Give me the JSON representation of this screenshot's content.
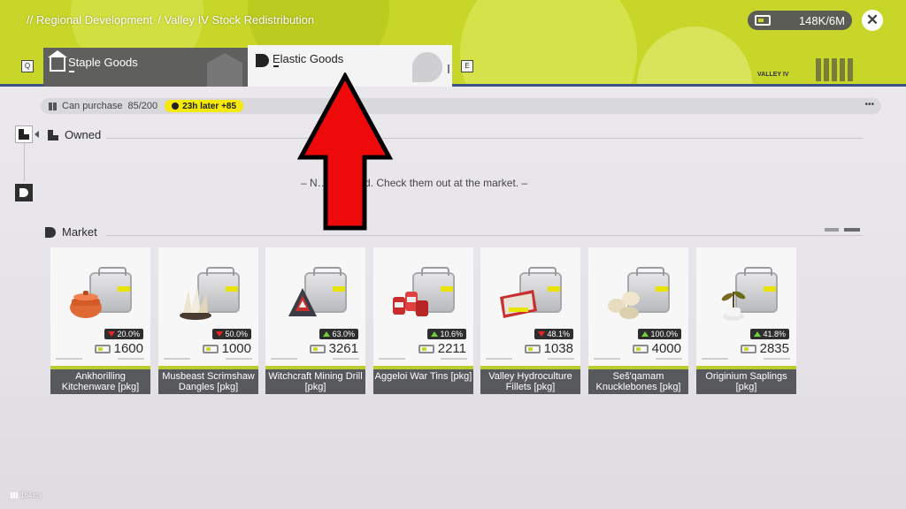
{
  "header": {
    "breadcrumb": [
      "// Regional Development",
      "/ Valley IV Stock Redistribution"
    ],
    "currency": {
      "icon": "currency-icon",
      "value": "148K/6M"
    },
    "close_icon": "close-icon",
    "key_left": "Q",
    "key_right": "E",
    "valley_label": "VALLEY IV",
    "colors": {
      "accent": "#c8d62a",
      "header_stripe": "#3e4f8a"
    }
  },
  "tabs": [
    {
      "label": "Staple Goods",
      "icon": "house-icon",
      "selected": false
    },
    {
      "label": "Elastic Goods",
      "icon": "elastic-icon",
      "selected": true
    }
  ],
  "purchase": {
    "label": "Can purchase",
    "value": "85/200",
    "timer": "23h later +85",
    "more": "•••"
  },
  "owned": {
    "title": "Owned",
    "empty_message": "– N… s owned. Check them out at the market. –"
  },
  "market": {
    "title": "Market",
    "items": [
      {
        "name": "Ankhorilling Kitchenware [pkg]",
        "change": "20.0%",
        "direction": "down",
        "price": "1600",
        "icon": "pot-icon"
      },
      {
        "name": "Musbeast Scrimshaw Dangles [pkg]",
        "change": "50.0%",
        "direction": "down",
        "price": "1000",
        "icon": "scrimshaw-icon"
      },
      {
        "name": "Witchcraft Mining Drill [pkg]",
        "change": "63.0%",
        "direction": "up",
        "price": "3261",
        "icon": "drill-icon"
      },
      {
        "name": "Aggeloi War Tins [pkg]",
        "change": "10.6%",
        "direction": "up",
        "price": "2211",
        "icon": "tins-icon"
      },
      {
        "name": "Valley Hydroculture Fillets [pkg]",
        "change": "48.1%",
        "direction": "down",
        "price": "1038",
        "icon": "fillets-icon"
      },
      {
        "name": "Seš'qamam Knucklebones [pkg]",
        "change": "100.0%",
        "direction": "up",
        "price": "4000",
        "icon": "knucklebones-icon"
      },
      {
        "name": "Originium Saplings [pkg]",
        "change": "41.8%",
        "direction": "up",
        "price": "2835",
        "icon": "sapling-icon"
      }
    ]
  },
  "footer": {
    "latency": "164ms"
  }
}
